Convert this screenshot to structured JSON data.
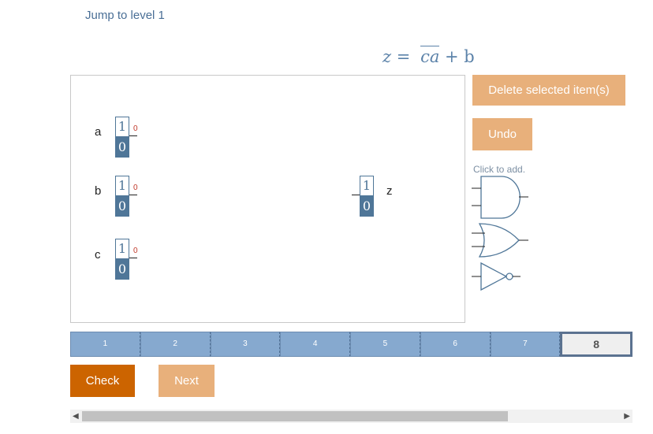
{
  "jump_link": "Jump to level 1",
  "formula": {
    "lhs": "z",
    "eq": "=",
    "overlined": "ca",
    "rest": "+ b"
  },
  "inputs": [
    {
      "label": "a",
      "top": "1",
      "bottom": "0",
      "output": "0"
    },
    {
      "label": "b",
      "top": "1",
      "bottom": "0",
      "output": "0"
    },
    {
      "label": "c",
      "top": "1",
      "bottom": "0",
      "output": "0"
    }
  ],
  "output_node": {
    "label": "z",
    "top": "1",
    "bottom": "0"
  },
  "buttons": {
    "delete": "Delete selected item(s)",
    "undo": "Undo",
    "check": "Check",
    "next": "Next"
  },
  "palette": {
    "hint": "Click to add.",
    "gates": [
      "and-gate-icon",
      "or-gate-icon",
      "not-gate-icon"
    ]
  },
  "levels": {
    "items": [
      "1",
      "2",
      "3",
      "4",
      "5",
      "6",
      "7",
      "8"
    ],
    "current": "8"
  },
  "colors": {
    "accent_blue": "#4f7698",
    "button_light": "#e8b07b",
    "button_dark": "#cc6400",
    "level_bar": "#86a9cf",
    "output_red": "#c0392b"
  }
}
